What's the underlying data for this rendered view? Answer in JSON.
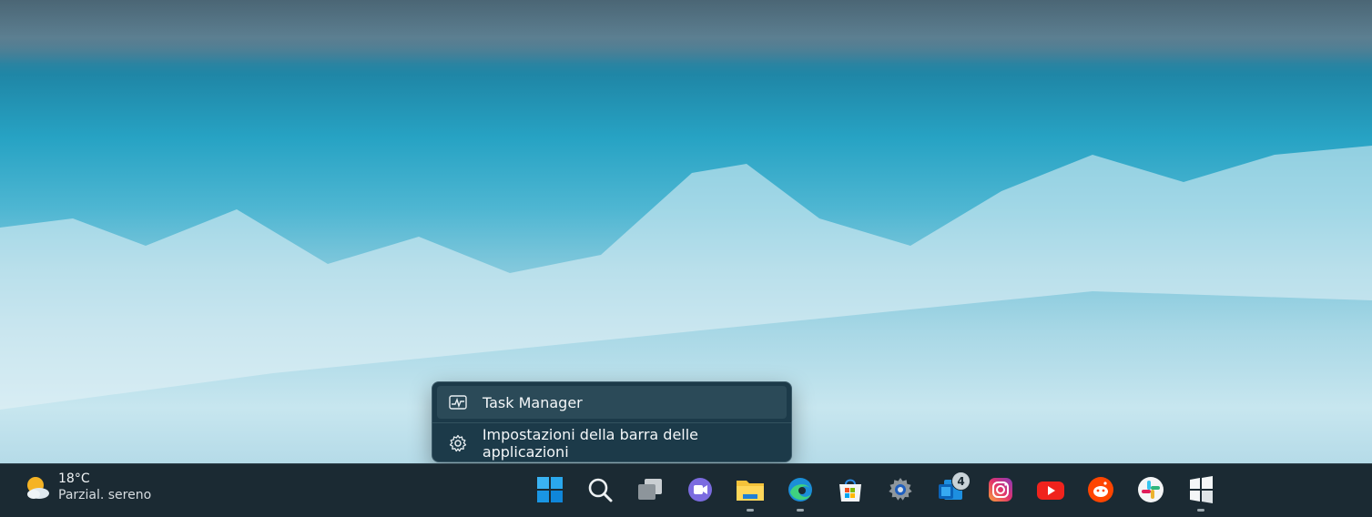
{
  "context_menu": {
    "items": [
      {
        "label": "Task Manager",
        "icon": "task-manager-icon"
      },
      {
        "label": "Impostazioni della barra delle applicazioni",
        "icon": "gear-icon"
      }
    ]
  },
  "weather": {
    "temperature": "18°C",
    "condition": "Parzial. sereno"
  },
  "taskbar": {
    "icons": [
      "windows-start-icon",
      "search-icon",
      "task-view-icon",
      "teams-chat-icon",
      "file-explorer-icon",
      "edge-icon",
      "microsoft-store-icon",
      "settings-icon",
      "outlook-mail-icon",
      "instagram-icon",
      "youtube-icon",
      "reddit-icon",
      "slack-icon",
      "windows-app-icon"
    ],
    "mail_badge": "4"
  },
  "colors": {
    "taskbar_bg": "#1b2a33",
    "menu_bg": "#1c3a49",
    "accent": "#0a84d8"
  }
}
